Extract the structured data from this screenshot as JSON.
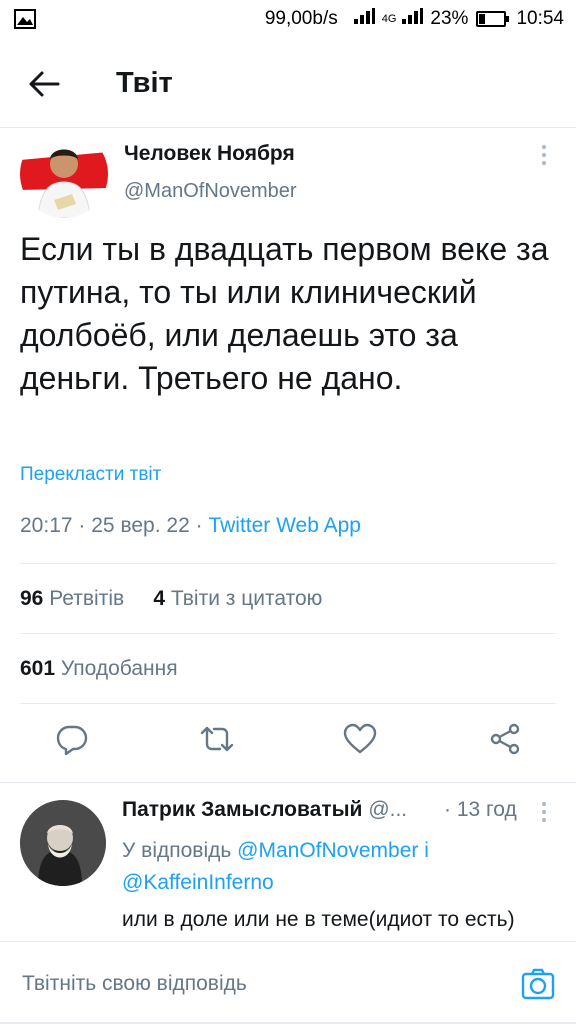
{
  "status_bar": {
    "speed": "99,00b/s",
    "network": "4G",
    "battery": "23%",
    "battery_level": 0.23,
    "time": "10:54"
  },
  "header": {
    "title": "Твіт"
  },
  "tweet": {
    "author_name": "Человек Ноября",
    "author_handle": "@ManOfNovember",
    "text": "Если ты в двадцать первом веке за путина, то ты или клинический долбоёб, или делаешь это за деньги. Третьего не дано.",
    "translate_label": "Перекласти твіт",
    "time": "20:17",
    "date": "25 вер. 22",
    "separator": "·",
    "source": "Twitter Web App",
    "retweets_count": "96",
    "retweets_label": "Ретвітів",
    "quotes_count": "4",
    "quotes_label": "Твіти з цитатою",
    "likes_count": "601",
    "likes_label": "Уподобання"
  },
  "reply": {
    "author_name": "Патрик Замысловатый",
    "author_handle": "@...",
    "time": "13 год",
    "reply_prefix": "У відповідь",
    "mention_1": "@ManOfNovember",
    "conj": "і",
    "mention_2": "@KaffeinInferno",
    "text": "или в доле или не в теме(идиот то есть)"
  },
  "composer": {
    "placeholder": "Твітніть свою відповідь"
  },
  "colors": {
    "accent": "#1da1f2",
    "secondary_text": "#657786",
    "primary_text": "#14171a",
    "divider": "#e6ecf0"
  },
  "icons": {
    "back": "arrow-left-icon",
    "more": "vertical-dots-icon",
    "reply": "comment-bubble-icon",
    "retweet": "retweet-arrows-icon",
    "like": "heart-outline-icon",
    "share": "share-nodes-icon",
    "camera": "camera-icon",
    "picture": "image-icon",
    "signal": "signal-bars-icon"
  }
}
